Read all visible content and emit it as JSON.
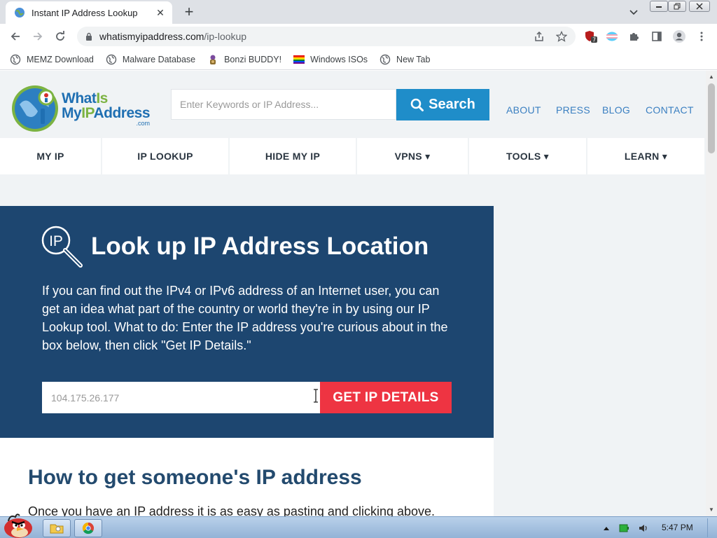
{
  "browser": {
    "tab_title": "Instant IP Address Lookup",
    "url_host": "whatismyipaddress.com",
    "url_path": "/ip-lookup",
    "extension_badge": "7",
    "bookmarks": [
      "MEMZ Download",
      "Malware Database",
      "Bonzi BUDDY!",
      "Windows ISOs",
      "New Tab"
    ]
  },
  "site": {
    "logo_line1_a": "What",
    "logo_line1_b": "Is",
    "logo_line2_a": "My",
    "logo_line2_b": "IP",
    "logo_line2_c": "Address",
    "logo_com": ".com",
    "search_placeholder": "Enter Keywords or IP Address...",
    "search_button": "Search",
    "top_links": [
      "ABOUT",
      "PRESS",
      "BLOG",
      "CONTACT"
    ],
    "nav": [
      "MY IP",
      "IP LOOKUP",
      "HIDE MY IP",
      "VPNS ▾",
      "TOOLS ▾",
      "LEARN ▾"
    ]
  },
  "hero": {
    "icon_text": "IP",
    "title": "Look up IP Address Location",
    "text": "If you can find out the IPv4 or IPv6 address of an Internet user, you can get an idea what part of the country or world they're in by using our IP Lookup tool. What to do: Enter the IP address you're curious about in the box below, then click \"Get IP Details.\"",
    "input_placeholder": "104.175.26.177",
    "button": "GET IP DETAILS"
  },
  "content": {
    "heading": "How to get someone's IP address",
    "text": "Once you have an IP address it is as easy as pasting and clicking above."
  },
  "taskbar": {
    "clock": "5:47 PM"
  },
  "colors": {
    "hero_bg": "#1d4670",
    "search_button": "#1f8dc9",
    "ip_button": "#ee3442",
    "heading": "#234a6e",
    "link": "#3a7fc1"
  }
}
